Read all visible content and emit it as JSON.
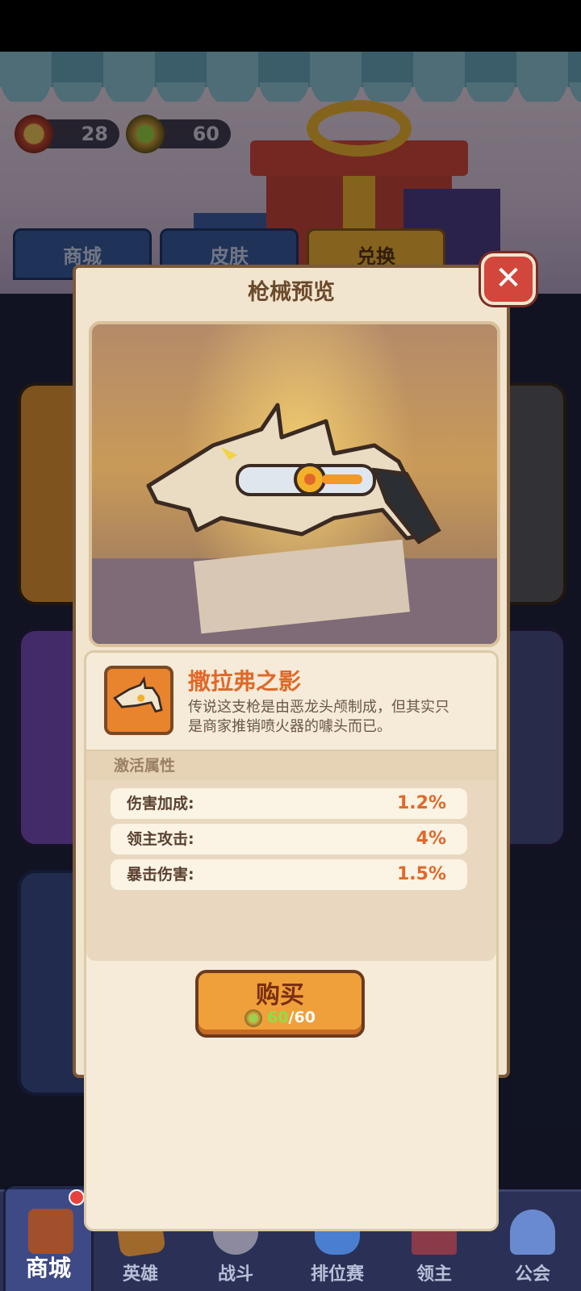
{
  "currencies": [
    {
      "name": "gem-currency",
      "value": "28"
    },
    {
      "name": "coin-currency",
      "value": "60"
    }
  ],
  "top_tabs": [
    "商城",
    "皮肤",
    "兑换"
  ],
  "modal": {
    "title": "枪械预览",
    "item": {
      "name": "撒拉弗之影",
      "description": "传说这支枪是由恶龙头颅制成，但其实只是商家推销喷火器的噱头而已。"
    },
    "attributes_header": "激活属性",
    "attributes": [
      {
        "label": "伤害加成:",
        "value": "1.2%"
      },
      {
        "label": "领主攻击:",
        "value": "4%"
      },
      {
        "label": "暴击伤害:",
        "value": "1.5%"
      }
    ],
    "buy": {
      "label": "购买",
      "have": "60",
      "separator": "/",
      "cost": "60"
    }
  },
  "bottom_nav": [
    "商城",
    "英雄",
    "战斗",
    "排位赛",
    "领主",
    "公会"
  ],
  "colors": {
    "accent_orange": "#e0692a",
    "close_red": "#d2463c",
    "modal_bg": "#f2e5cf"
  }
}
